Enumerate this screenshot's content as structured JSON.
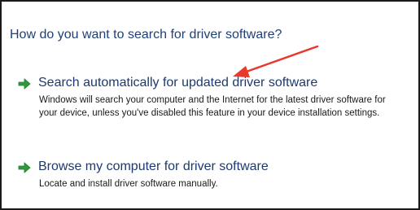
{
  "dialog": {
    "heading": "How do you want to search for driver software?",
    "options": [
      {
        "icon": "green-arrow-icon",
        "title": "Search automatically for updated driver software",
        "description": "Windows will search your computer and the Internet for the latest driver software for your device, unless you've disabled this feature in your device installation settings."
      },
      {
        "icon": "green-arrow-icon",
        "title": "Browse my computer for driver software",
        "description": "Locate and install driver software manually."
      }
    ]
  },
  "colors": {
    "heading": "#1e3f78",
    "option_title": "#1c3a70",
    "arrow_icon": "#2e9a3a",
    "annotation_arrow": "#e8392c"
  }
}
